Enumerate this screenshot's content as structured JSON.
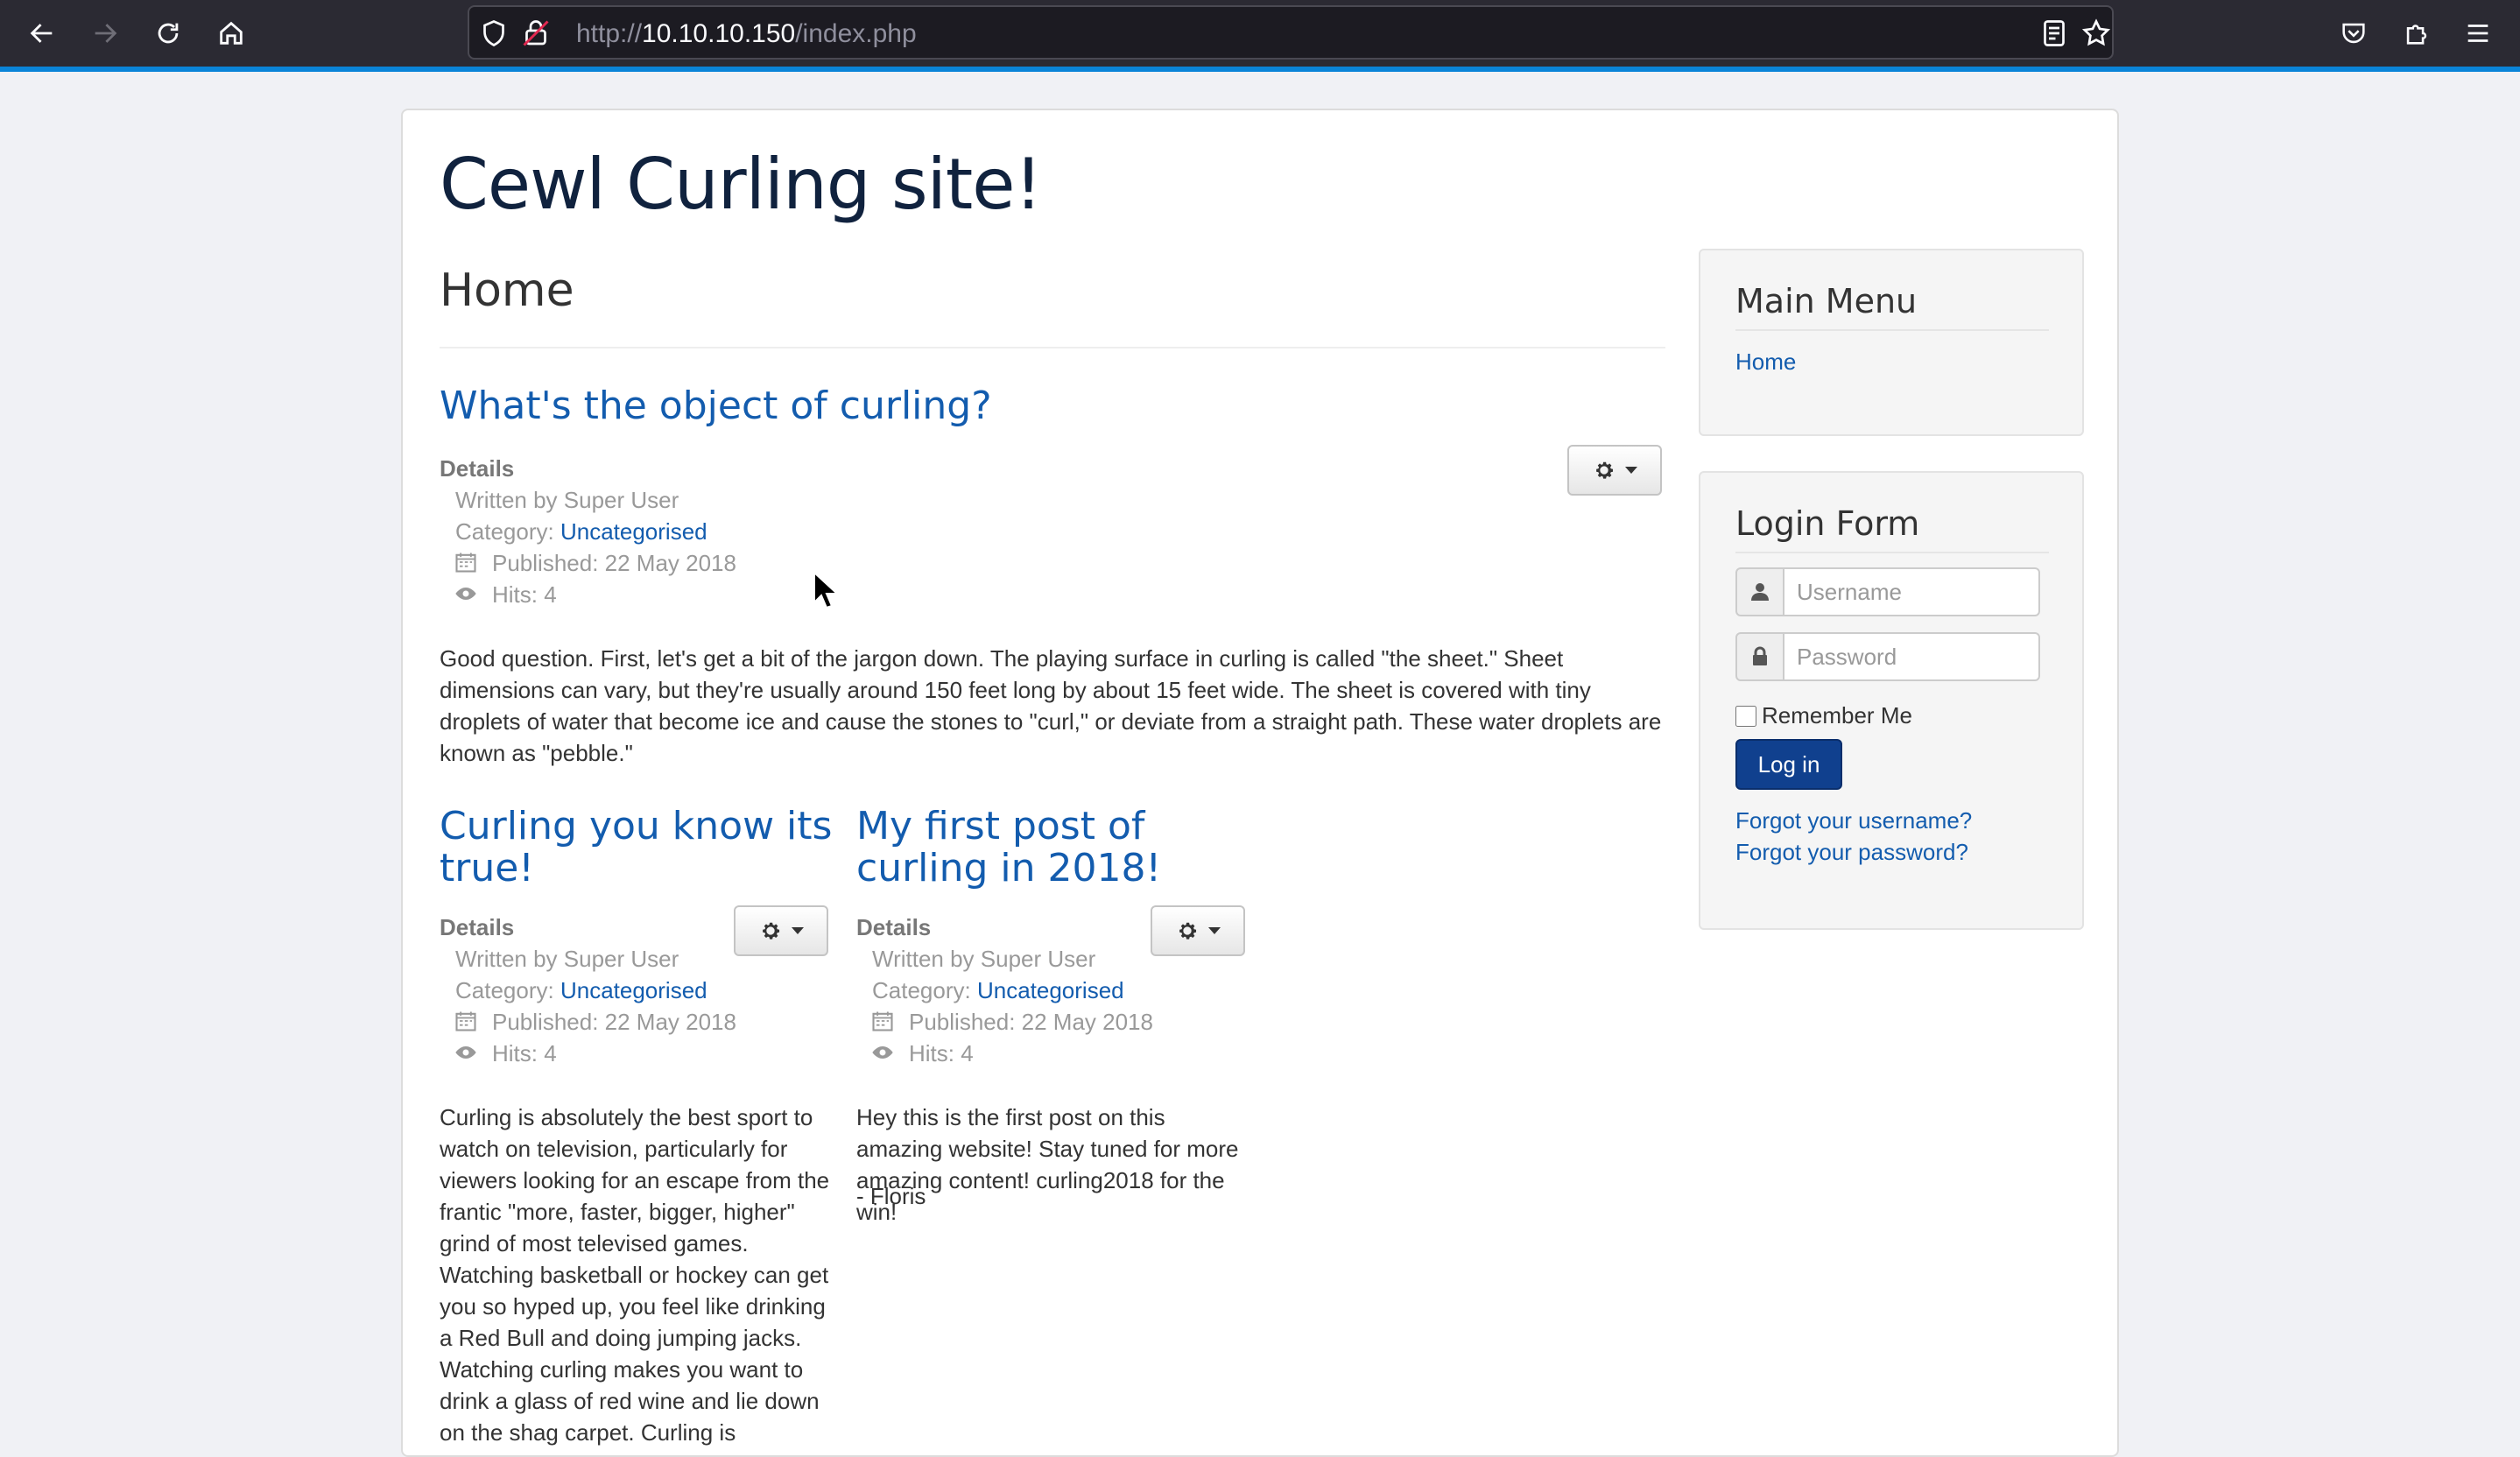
{
  "browser": {
    "url_prefix": "http://",
    "url_host": "10.10.10.150",
    "url_path": "/index.php"
  },
  "site": {
    "title": "Cewl Curling site!",
    "page_heading": "Home"
  },
  "articles": [
    {
      "title": "What's the object of curling?",
      "details_label": "Details",
      "written_by": "Written by Super User",
      "category_label": "Category: ",
      "category": "Uncategorised",
      "published": "Published: 22 May 2018",
      "hits": "Hits: 4",
      "body": "Good question. First, let's get a bit of the jargon down. The playing surface in curling is called \"the sheet.\" Sheet dimensions can vary, but they're usually around 150 feet long by about 15 feet wide. The sheet is covered with tiny droplets of water that become ice and cause the stones to \"curl,\" or deviate from a straight path. These water droplets are known as \"pebble.\""
    },
    {
      "title": "Curling you know its true!",
      "details_label": "Details",
      "written_by": "Written by Super User",
      "category_label": "Category: ",
      "category": "Uncategorised",
      "published": "Published: 22 May 2018",
      "hits": "Hits: 4",
      "body": "Curling is absolutely the best sport to watch on television, particularly for viewers looking for an escape from the frantic \"more, faster, bigger, higher\" grind of most televised games. Watching basketball or hockey can get you so hyped up, you feel like drinking a Red Bull and doing jumping jacks. Watching curling makes you want to drink a glass of red wine and lie down on the shag carpet. Curling is"
    },
    {
      "title": "My first post of curling in 2018!",
      "details_label": "Details",
      "written_by": "Written by Super User",
      "category_label": "Category: ",
      "category": "Uncategorised",
      "published": "Published: 22 May 2018",
      "hits": "Hits: 4",
      "body": "Hey this is the first post on this amazing website! Stay tuned for more amazing content! curling2018 for the win!",
      "signature": "- Floris"
    }
  ],
  "sidebar": {
    "main_menu": {
      "title": "Main Menu",
      "items": [
        "Home"
      ]
    },
    "login_form": {
      "title": "Login Form",
      "username_placeholder": "Username",
      "password_placeholder": "Password",
      "remember_label": "Remember Me",
      "login_button": "Log in",
      "forgot_username": "Forgot your username?",
      "forgot_password": "Forgot your password?"
    }
  },
  "colors": {
    "link": "#135cae",
    "title": "#10223e",
    "primary_button": "#10408e"
  }
}
